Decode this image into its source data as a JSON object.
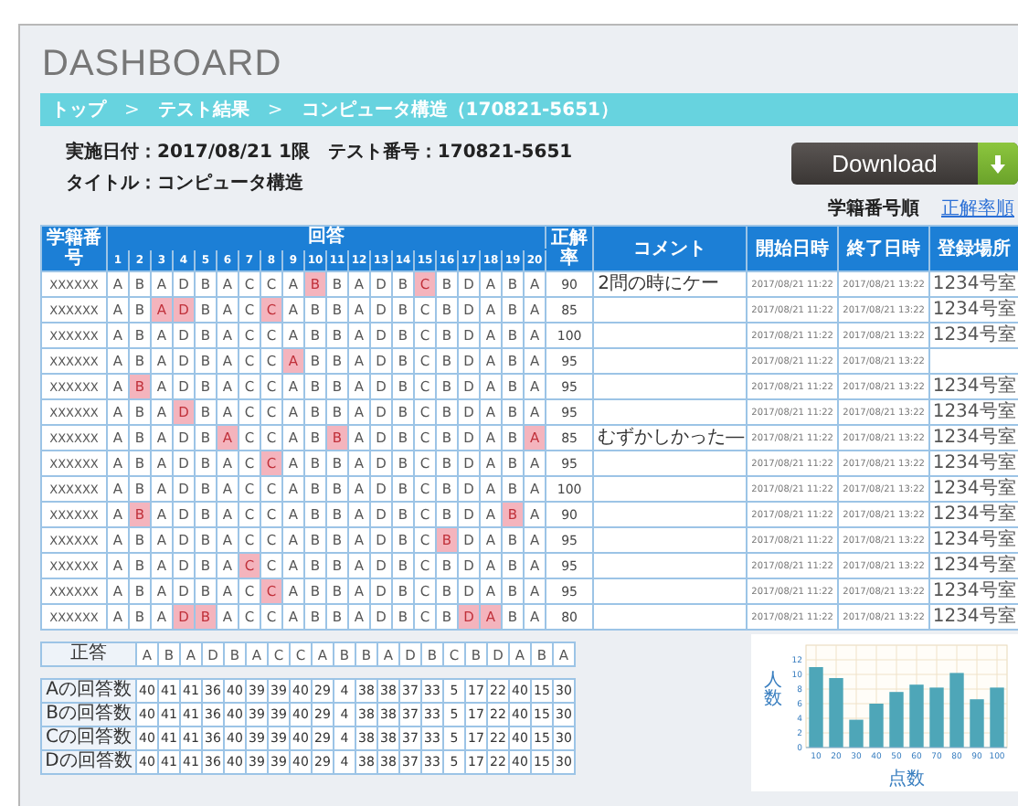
{
  "title": "DASHBOARD",
  "breadcrumb": [
    {
      "kind": "link",
      "text": "トップ"
    },
    {
      "kind": "separator",
      "text": ">"
    },
    {
      "kind": "link",
      "text": "テスト結果"
    },
    {
      "kind": "separator",
      "text": ">"
    },
    {
      "kind": "link",
      "text": "コンピュータ構造（170821-5651）"
    }
  ],
  "info": [
    "実施日付：2017/08/21 1限　テスト番号：170821-5651",
    "タイトル：コンピュータ構造"
  ],
  "download_button": {
    "label": "Download"
  },
  "sort_links": [
    {
      "label": "学籍番号順",
      "selected": true
    },
    {
      "label": "正解率順",
      "selected": false
    }
  ],
  "table": {
    "id_header": "学籍番号",
    "answers_header": "回答",
    "numbers": [
      "1",
      "2",
      "3",
      "4",
      "5",
      "6",
      "7",
      "8",
      "9",
      "10",
      "11",
      "12",
      "13",
      "14",
      "15",
      "16",
      "17",
      "18",
      "19",
      "20"
    ],
    "score_header": "正解率",
    "comment_header": "コメント",
    "start_header": "開始日時",
    "end_header": "終了日時",
    "place_header": "登録場所",
    "rows": [
      {
        "id": "XXXXXX",
        "answers": [
          "A",
          "B",
          "A",
          "D",
          "B",
          "A",
          "C",
          "C",
          "A",
          "B",
          "B",
          "A",
          "D",
          "B",
          "C",
          "B",
          "D",
          "A",
          "B",
          "A"
        ],
        "wrong": [
          false,
          false,
          false,
          false,
          false,
          false,
          false,
          false,
          false,
          true,
          false,
          false,
          false,
          false,
          true,
          false,
          false,
          false,
          false,
          false
        ],
        "score": "90",
        "comment": "2問の時にケー",
        "start": "2017/08/21 11:22",
        "end": "2017/08/21 13:22",
        "place": "1234号室"
      },
      {
        "id": "XXXXXX",
        "answers": [
          "A",
          "B",
          "A",
          "D",
          "B",
          "A",
          "C",
          "C",
          "A",
          "B",
          "B",
          "A",
          "D",
          "B",
          "C",
          "B",
          "D",
          "A",
          "B",
          "A"
        ],
        "wrong": [
          false,
          false,
          true,
          true,
          false,
          false,
          false,
          true,
          false,
          false,
          false,
          false,
          false,
          false,
          false,
          false,
          false,
          false,
          false,
          false
        ],
        "score": "85",
        "start": "2017/08/21 11:22",
        "end": "2017/08/21 13:22",
        "place": "1234号室"
      },
      {
        "id": "XXXXXX",
        "answers": [
          "A",
          "B",
          "A",
          "D",
          "B",
          "A",
          "C",
          "C",
          "A",
          "B",
          "B",
          "A",
          "D",
          "B",
          "C",
          "B",
          "D",
          "A",
          "B",
          "A"
        ],
        "wrong": [
          false,
          false,
          false,
          false,
          false,
          false,
          false,
          false,
          false,
          false,
          false,
          false,
          false,
          false,
          false,
          false,
          false,
          false,
          false,
          false
        ],
        "score": "100",
        "start": "2017/08/21 11:22",
        "end": "2017/08/21 13:22",
        "place": "1234号室"
      },
      {
        "id": "XXXXXX",
        "answers": [
          "A",
          "B",
          "A",
          "D",
          "B",
          "A",
          "C",
          "C",
          "A",
          "B",
          "B",
          "A",
          "D",
          "B",
          "C",
          "B",
          "D",
          "A",
          "B",
          "A"
        ],
        "wrong": [
          false,
          false,
          false,
          false,
          false,
          false,
          false,
          false,
          true,
          false,
          false,
          false,
          false,
          false,
          false,
          false,
          false,
          false,
          false,
          false
        ],
        "score": "95",
        "start": "2017/08/21 11:22",
        "end": "2017/08/21 13:22"
      },
      {
        "id": "XXXXXX",
        "answers": [
          "A",
          "B",
          "A",
          "D",
          "B",
          "A",
          "C",
          "C",
          "A",
          "B",
          "B",
          "A",
          "D",
          "B",
          "C",
          "B",
          "D",
          "A",
          "B",
          "A"
        ],
        "wrong": [
          false,
          true,
          false,
          false,
          false,
          false,
          false,
          false,
          false,
          false,
          false,
          false,
          false,
          false,
          false,
          false,
          false,
          false,
          false,
          false
        ],
        "score": "95",
        "start": "2017/08/21 11:22",
        "end": "2017/08/21 13:22",
        "place": "1234号室"
      },
      {
        "id": "XXXXXX",
        "answers": [
          "A",
          "B",
          "A",
          "D",
          "B",
          "A",
          "C",
          "C",
          "A",
          "B",
          "B",
          "A",
          "D",
          "B",
          "C",
          "B",
          "D",
          "A",
          "B",
          "A"
        ],
        "wrong": [
          false,
          false,
          false,
          true,
          false,
          false,
          false,
          false,
          false,
          false,
          false,
          false,
          false,
          false,
          false,
          false,
          false,
          false,
          false,
          false
        ],
        "score": "95",
        "start": "2017/08/21 11:22",
        "end": "2017/08/21 13:22",
        "place": "1234号室"
      },
      {
        "id": "XXXXXX",
        "answers": [
          "A",
          "B",
          "A",
          "D",
          "B",
          "A",
          "C",
          "C",
          "A",
          "B",
          "B",
          "A",
          "D",
          "B",
          "C",
          "B",
          "D",
          "A",
          "B",
          "A"
        ],
        "wrong": [
          false,
          false,
          false,
          false,
          false,
          true,
          false,
          false,
          false,
          false,
          true,
          false,
          false,
          false,
          false,
          false,
          false,
          false,
          false,
          true
        ],
        "score": "85",
        "comment": "むずかしかった―",
        "start": "2017/08/21 11:22",
        "end": "2017/08/21 13:22",
        "place": "1234号室"
      },
      {
        "id": "XXXXXX",
        "answers": [
          "A",
          "B",
          "A",
          "D",
          "B",
          "A",
          "C",
          "C",
          "A",
          "B",
          "B",
          "A",
          "D",
          "B",
          "C",
          "B",
          "D",
          "A",
          "B",
          "A"
        ],
        "wrong": [
          false,
          false,
          false,
          false,
          false,
          false,
          false,
          true,
          false,
          false,
          false,
          false,
          false,
          false,
          false,
          false,
          false,
          false,
          false,
          false
        ],
        "score": "95",
        "start": "2017/08/21 11:22",
        "end": "2017/08/21 13:22",
        "place": "1234号室"
      },
      {
        "id": "XXXXXX",
        "answers": [
          "A",
          "B",
          "A",
          "D",
          "B",
          "A",
          "C",
          "C",
          "A",
          "B",
          "B",
          "A",
          "D",
          "B",
          "C",
          "B",
          "D",
          "A",
          "B",
          "A"
        ],
        "wrong": [
          false,
          false,
          false,
          false,
          false,
          false,
          false,
          false,
          false,
          false,
          false,
          false,
          false,
          false,
          false,
          false,
          false,
          false,
          false,
          false
        ],
        "score": "100",
        "start": "2017/08/21 11:22",
        "end": "2017/08/21 13:22",
        "place": "1234号室"
      },
      {
        "id": "XXXXXX",
        "answers": [
          "A",
          "B",
          "A",
          "D",
          "B",
          "A",
          "C",
          "C",
          "A",
          "B",
          "B",
          "A",
          "D",
          "B",
          "C",
          "B",
          "D",
          "A",
          "B",
          "A"
        ],
        "wrong": [
          false,
          true,
          false,
          false,
          false,
          false,
          false,
          false,
          false,
          false,
          false,
          false,
          false,
          false,
          false,
          false,
          false,
          false,
          true,
          false
        ],
        "score": "90",
        "start": "2017/08/21 11:22",
        "end": "2017/08/21 13:22",
        "place": "1234号室"
      },
      {
        "id": "XXXXXX",
        "answers": [
          "A",
          "B",
          "A",
          "D",
          "B",
          "A",
          "C",
          "C",
          "A",
          "B",
          "B",
          "A",
          "D",
          "B",
          "C",
          "B",
          "D",
          "A",
          "B",
          "A"
        ],
        "wrong": [
          false,
          false,
          false,
          false,
          false,
          false,
          false,
          false,
          false,
          false,
          false,
          false,
          false,
          false,
          false,
          true,
          false,
          false,
          false,
          false
        ],
        "score": "95",
        "start": "2017/08/21 11:22",
        "end": "2017/08/21 13:22",
        "place": "1234号室"
      },
      {
        "id": "XXXXXX",
        "answers": [
          "A",
          "B",
          "A",
          "D",
          "B",
          "A",
          "C",
          "C",
          "A",
          "B",
          "B",
          "A",
          "D",
          "B",
          "C",
          "B",
          "D",
          "A",
          "B",
          "A"
        ],
        "wrong": [
          false,
          false,
          false,
          false,
          false,
          false,
          true,
          false,
          false,
          false,
          false,
          false,
          false,
          false,
          false,
          false,
          false,
          false,
          false,
          false
        ],
        "score": "95",
        "start": "2017/08/21 11:22",
        "end": "2017/08/21 13:22",
        "place": "1234号室"
      },
      {
        "id": "XXXXXX",
        "answers": [
          "A",
          "B",
          "A",
          "D",
          "B",
          "A",
          "C",
          "C",
          "A",
          "B",
          "B",
          "A",
          "D",
          "B",
          "C",
          "B",
          "D",
          "A",
          "B",
          "A"
        ],
        "wrong": [
          false,
          false,
          false,
          false,
          false,
          false,
          false,
          true,
          false,
          false,
          false,
          false,
          false,
          false,
          false,
          false,
          false,
          false,
          false,
          false
        ],
        "score": "95",
        "start": "2017/08/21 11:22",
        "end": "2017/08/21 13:22",
        "place": "1234号室"
      },
      {
        "id": "XXXXXX",
        "answers": [
          "A",
          "B",
          "A",
          "D",
          "B",
          "A",
          "C",
          "C",
          "A",
          "B",
          "B",
          "A",
          "D",
          "B",
          "C",
          "B",
          "D",
          "A",
          "B",
          "A"
        ],
        "wrong": [
          false,
          false,
          false,
          true,
          true,
          false,
          false,
          false,
          false,
          false,
          false,
          false,
          false,
          false,
          false,
          false,
          true,
          true,
          false,
          false
        ],
        "score": "80",
        "start": "2017/08/21 11:22",
        "end": "2017/08/21 13:22",
        "place": "1234号室"
      }
    ]
  },
  "answer_key": {
    "label": "正答",
    "answers": [
      "A",
      "B",
      "A",
      "D",
      "B",
      "A",
      "C",
      "C",
      "A",
      "B",
      "B",
      "A",
      "D",
      "B",
      "C",
      "B",
      "D",
      "A",
      "B",
      "A"
    ]
  },
  "tally_rows": [
    {
      "label": "Aの回答数",
      "counts": [
        "40",
        "41",
        "41",
        "36",
        "40",
        "39",
        "39",
        "40",
        "29",
        "4",
        "38",
        "38",
        "37",
        "33",
        "5",
        "17",
        "22",
        "40",
        "15",
        "30"
      ]
    },
    {
      "label": "Bの回答数",
      "counts": [
        "40",
        "41",
        "41",
        "36",
        "40",
        "39",
        "39",
        "40",
        "29",
        "4",
        "38",
        "38",
        "37",
        "33",
        "5",
        "17",
        "22",
        "40",
        "15",
        "30"
      ]
    },
    {
      "label": "Cの回答数",
      "counts": [
        "40",
        "41",
        "41",
        "36",
        "40",
        "39",
        "39",
        "40",
        "29",
        "4",
        "38",
        "38",
        "37",
        "33",
        "5",
        "17",
        "22",
        "40",
        "15",
        "30"
      ]
    },
    {
      "label": "Dの回答数",
      "counts": [
        "40",
        "41",
        "41",
        "36",
        "40",
        "39",
        "39",
        "40",
        "29",
        "4",
        "38",
        "38",
        "37",
        "33",
        "5",
        "17",
        "22",
        "40",
        "15",
        "30"
      ]
    }
  ],
  "score_chart": {
    "chart_data": {
      "type": "bar",
      "xlabel": "点数",
      "ylabel": "人数",
      "categories": [
        "10",
        "20",
        "30",
        "40",
        "50",
        "60",
        "70",
        "80",
        "90",
        "100"
      ],
      "values": [
        11,
        9.5,
        3.8,
        6,
        7.6,
        8.6,
        8.2,
        10.2,
        6.6,
        8.2
      ],
      "ylim": [
        0,
        14
      ],
      "yticks": [
        0,
        2,
        4,
        6,
        8,
        10,
        12
      ],
      "grid": true
    }
  }
}
